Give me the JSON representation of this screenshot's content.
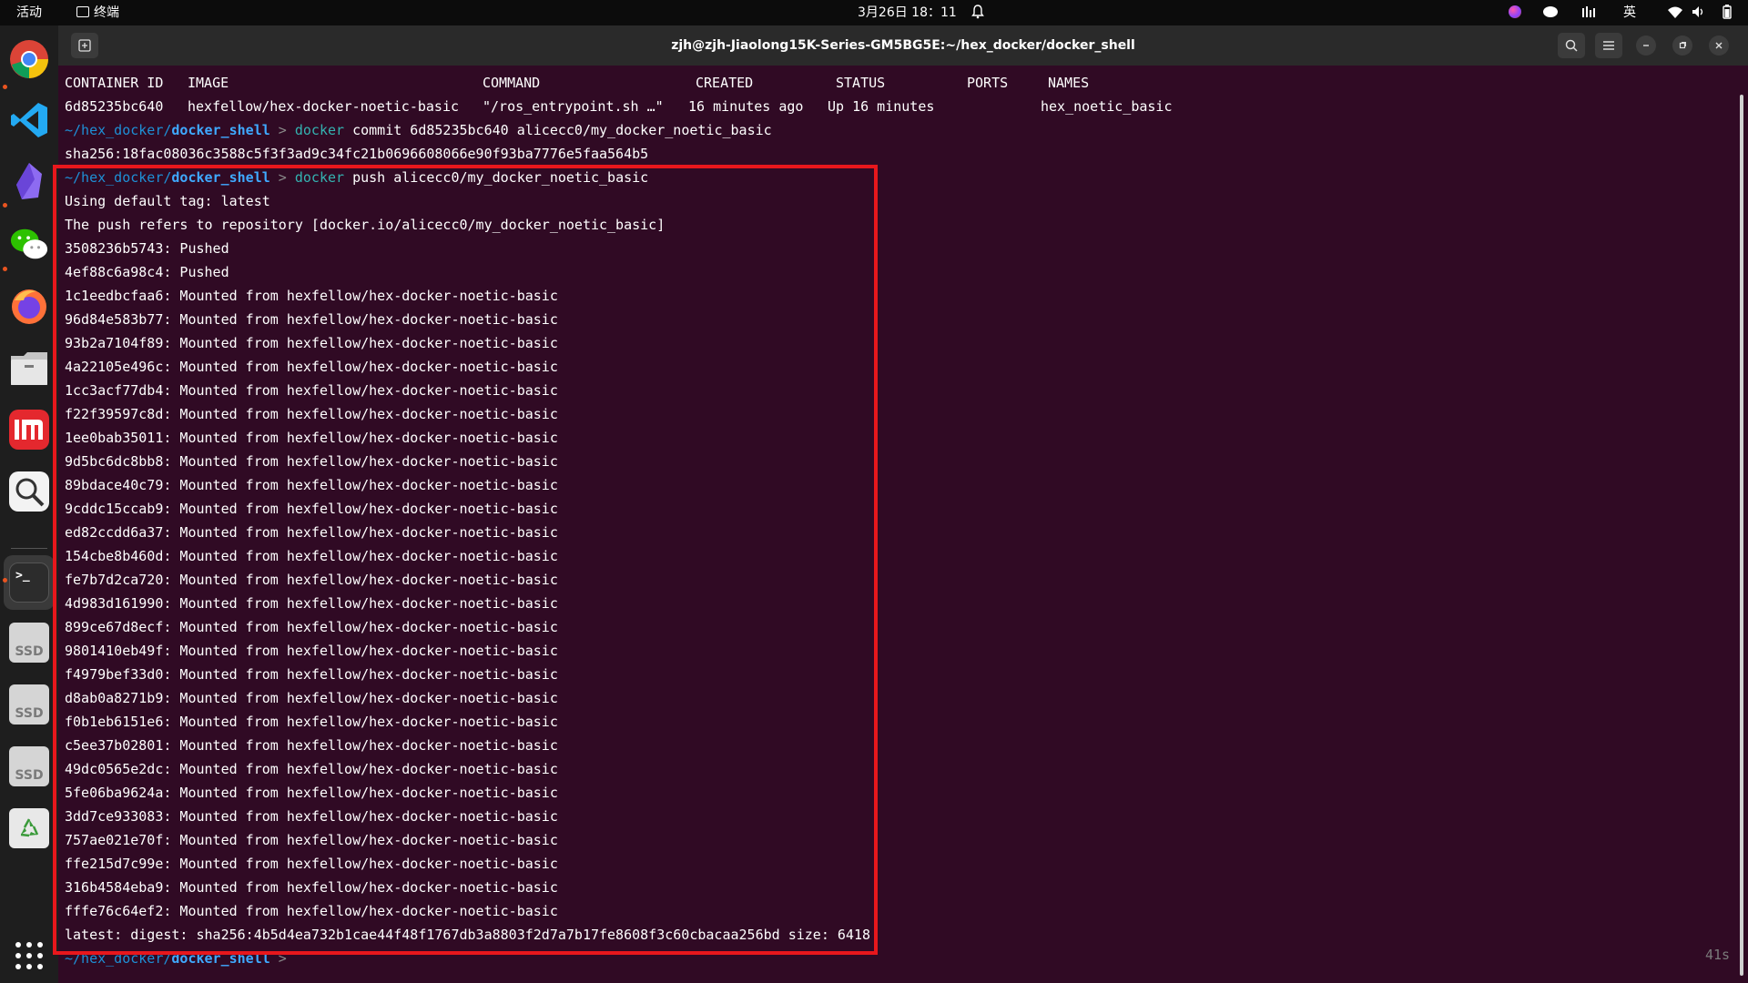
{
  "topbar": {
    "activities": "活动",
    "app_name": "终端",
    "datetime": "3月26日  18：11",
    "input_method": "英"
  },
  "window": {
    "title": "zjh@zjh-Jiaolong15K-Series-GM5BG5E:~/hex_docker/docker_shell"
  },
  "dock": {
    "ssd_label": "SSD"
  },
  "ps": {
    "headers": [
      "CONTAINER ID",
      "IMAGE",
      "COMMAND",
      "CREATED",
      "STATUS",
      "PORTS",
      "NAMES"
    ],
    "row": [
      "6d85235bc640",
      "hexfellow/hex-docker-noetic-basic",
      "\"/ros_entrypoint.sh …\"",
      "16 minutes ago",
      "Up 16 minutes",
      "",
      "hex_noetic_basic"
    ]
  },
  "prompt": {
    "path_prefix": "~/hex_docker/",
    "path_dir": "docker_shell",
    "arrow": " > ",
    "docker_word": "docker"
  },
  "commit": {
    "args": " commit 6d85235bc640 alicecc0/my_docker_noetic_basic",
    "output": "sha256:18fac08036c3588c5f3f3ad9c34fc21b0696608066e90f93ba7776e5faa564b5"
  },
  "push": {
    "args": " push alicecc0/my_docker_noetic_basic",
    "lines": [
      "Using default tag: latest",
      "The push refers to repository [docker.io/alicecc0/my_docker_noetic_basic]",
      "3508236b5743: Pushed",
      "4ef88c6a98c4: Pushed",
      "1c1eedbcfaa6: Mounted from hexfellow/hex-docker-noetic-basic",
      "96d84e583b77: Mounted from hexfellow/hex-docker-noetic-basic",
      "93b2a7104f89: Mounted from hexfellow/hex-docker-noetic-basic",
      "4a22105e496c: Mounted from hexfellow/hex-docker-noetic-basic",
      "1cc3acf77db4: Mounted from hexfellow/hex-docker-noetic-basic",
      "f22f39597c8d: Mounted from hexfellow/hex-docker-noetic-basic",
      "1ee0bab35011: Mounted from hexfellow/hex-docker-noetic-basic",
      "9d5bc6dc8bb8: Mounted from hexfellow/hex-docker-noetic-basic",
      "89bdace40c79: Mounted from hexfellow/hex-docker-noetic-basic",
      "9cddc15ccab9: Mounted from hexfellow/hex-docker-noetic-basic",
      "ed82ccdd6a37: Mounted from hexfellow/hex-docker-noetic-basic",
      "154cbe8b460d: Mounted from hexfellow/hex-docker-noetic-basic",
      "fe7b7d2ca720: Mounted from hexfellow/hex-docker-noetic-basic",
      "4d983d161990: Mounted from hexfellow/hex-docker-noetic-basic",
      "899ce67d8ecf: Mounted from hexfellow/hex-docker-noetic-basic",
      "9801410eb49f: Mounted from hexfellow/hex-docker-noetic-basic",
      "f4979bef33d0: Mounted from hexfellow/hex-docker-noetic-basic",
      "d8ab0a8271b9: Mounted from hexfellow/hex-docker-noetic-basic",
      "f0b1eb6151e6: Mounted from hexfellow/hex-docker-noetic-basic",
      "c5ee37b02801: Mounted from hexfellow/hex-docker-noetic-basic",
      "49dc0565e2dc: Mounted from hexfellow/hex-docker-noetic-basic",
      "5fe06ba9624a: Mounted from hexfellow/hex-docker-noetic-basic",
      "3dd7ce933083: Mounted from hexfellow/hex-docker-noetic-basic",
      "757ae021e70f: Mounted from hexfellow/hex-docker-noetic-basic",
      "ffe215d7c99e: Mounted from hexfellow/hex-docker-noetic-basic",
      "316b4584eba9: Mounted from hexfellow/hex-docker-noetic-basic",
      "fffe76c64ef2: Mounted from hexfellow/hex-docker-noetic-basic",
      "latest: digest: sha256:4b5d4ea732b1cae44f48f1767db3a8803f2d7a7b17fe8608f3c60cbacaa256bd size: 6418"
    ]
  },
  "elapsed": "41s",
  "colors": {
    "terminal_bg": "#300a24",
    "highlight_border": "#e8171c",
    "prompt_path": "#1e90d6",
    "command_word": "#34b3b1"
  },
  "icons": {
    "topbar_right": [
      "firefox-color-icon",
      "wechat-icon",
      "input-method-icon",
      "wifi-icon",
      "volume-icon",
      "battery-icon"
    ],
    "dock": [
      "chrome-icon",
      "vscode-icon",
      "obsidian-icon",
      "wechat-icon",
      "firefox-icon",
      "files-icon",
      "mi-icon",
      "image-viewer-icon",
      "terminal-icon",
      "ssd-drive-icon",
      "ssd-drive-icon",
      "ssd-drive-icon",
      "trash-icon",
      "apps-grid-icon"
    ]
  }
}
